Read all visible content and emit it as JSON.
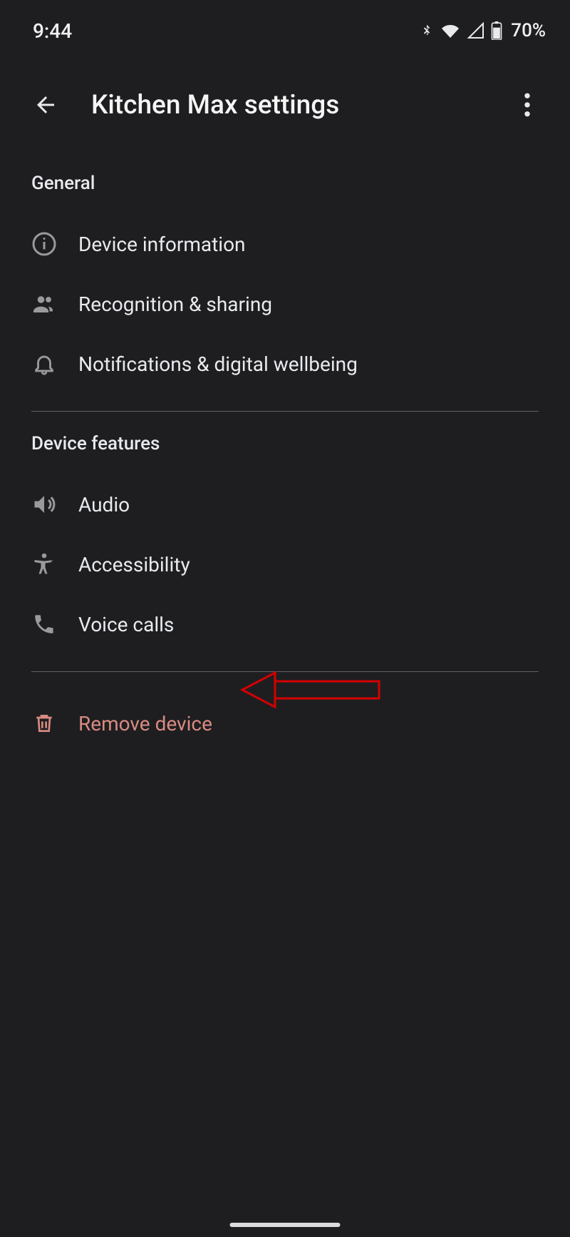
{
  "status_bar": {
    "time": "9:44",
    "battery_text": "70%"
  },
  "header": {
    "title": "Kitchen Max settings"
  },
  "sections": {
    "general": {
      "header": "General",
      "items": [
        {
          "label": "Device information"
        },
        {
          "label": "Recognition & sharing"
        },
        {
          "label": "Notifications & digital wellbeing"
        }
      ]
    },
    "device_features": {
      "header": "Device features",
      "items": [
        {
          "label": "Audio"
        },
        {
          "label": "Accessibility"
        },
        {
          "label": "Voice calls"
        }
      ]
    },
    "remove": {
      "label": "Remove device"
    }
  }
}
